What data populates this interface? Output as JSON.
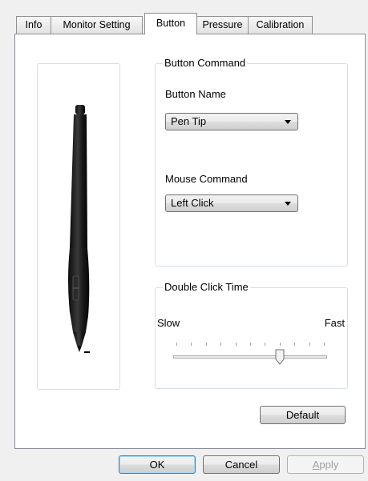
{
  "tabs": [
    {
      "label": "Info",
      "active": false
    },
    {
      "label": "Monitor Setting",
      "active": false
    },
    {
      "label": "Button",
      "active": true
    },
    {
      "label": "Pressure",
      "active": false
    },
    {
      "label": "Calibration",
      "active": false
    }
  ],
  "button_command": {
    "legend": "Button Command",
    "button_name_label": "Button Name",
    "button_name_value": "Pen Tip",
    "mouse_command_label": "Mouse Command",
    "mouse_command_value": "Left Click"
  },
  "double_click": {
    "legend": "Double Click Time",
    "slow_label": "Slow",
    "fast_label": "Fast",
    "tick_count": 11,
    "value_position": 7
  },
  "buttons": {
    "default": "Default",
    "ok": "OK",
    "cancel": "Cancel",
    "apply": "Apply"
  },
  "colors": {
    "pen_body": "#1a1a1a",
    "focus_border": "#3c7fb1"
  }
}
